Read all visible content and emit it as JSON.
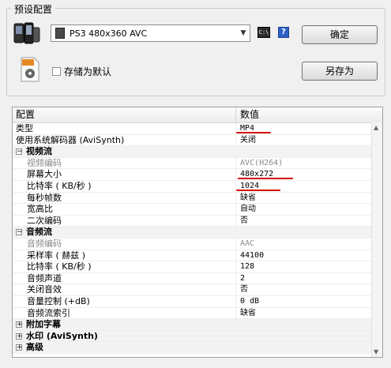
{
  "preset": {
    "group_title": "预设配置",
    "profile_value": "PS3 480x360 AVC",
    "ok_label": "确定",
    "saveas_label": "另存为",
    "save_default_label": "存储为默认",
    "save_default_checked": false,
    "mp4_icon_text": "MP4"
  },
  "grid": {
    "col_name": "配置",
    "col_value": "数值",
    "rows": [
      {
        "name": "类型",
        "value": "MP4"
      },
      {
        "name": "使用系统解码器 (AviSynth)",
        "value": "关闭"
      },
      {
        "name": "视频流",
        "value": ""
      },
      {
        "name": "视频编码",
        "value": "AVC(H264)"
      },
      {
        "name": "屏幕大小",
        "value": "480x272"
      },
      {
        "name": "比特率 ( KB/秒 )",
        "value": "1024"
      },
      {
        "name": "每秒帧数",
        "value": "缺省"
      },
      {
        "name": "宽高比",
        "value": "自动"
      },
      {
        "name": "二次编码",
        "value": "否"
      },
      {
        "name": "音频流",
        "value": ""
      },
      {
        "name": "音频编码",
        "value": "AAC"
      },
      {
        "name": "采样率 ( 赫兹 )",
        "value": "44100"
      },
      {
        "name": "比特率 ( KB/秒 )",
        "value": "128"
      },
      {
        "name": "音频声道",
        "value": "2"
      },
      {
        "name": "关闭音效",
        "value": "否"
      },
      {
        "name": "音量控制 (+dB)",
        "value": "0 dB"
      },
      {
        "name": "音频流索引",
        "value": "缺省"
      },
      {
        "name": "附加字幕",
        "value": ""
      },
      {
        "name": "水印 (AviSynth)",
        "value": ""
      },
      {
        "name": "高级",
        "value": ""
      }
    ]
  },
  "annotation_color": "#d20000"
}
